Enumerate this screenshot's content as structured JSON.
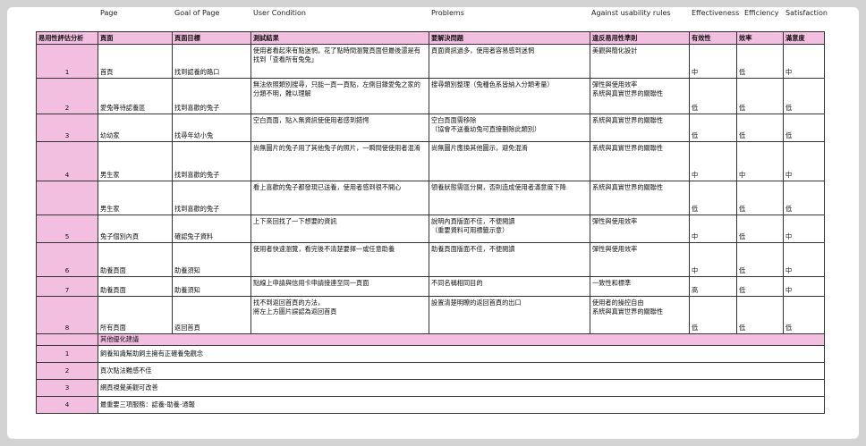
{
  "english_headers": {
    "page": "Page",
    "goal": "Goal of Page",
    "condition": "User Condition",
    "problems": "Problems",
    "rules": "Against usability rules",
    "effectiveness": "Effectiveness",
    "efficiency": "Efficiency",
    "satisfaction": "Satisfaction"
  },
  "table_header": {
    "title": "易用性評估分析",
    "page": "頁面",
    "goal": "頁面目標",
    "result": "測試結果",
    "problem": "要解決問題",
    "rule": "違反易用性準則",
    "effectiveness": "有效性",
    "efficiency": "效率",
    "satisfaction": "滿意度"
  },
  "rows": [
    {
      "idx": "1",
      "page": "首頁",
      "goal": "找到認養的路口",
      "result": "使用者看起來有點迷惘，花了點時間瀏覽頁面但最後還是有找到「查看所有兔兔」",
      "problem": "頁面資訊過多，使用者容易感到迷惘",
      "rule": "美觀與簡化設計",
      "eff": "中",
      "effc": "低",
      "sat": "中"
    },
    {
      "idx": "2",
      "page": "愛兔等待認養區",
      "goal": "找到喜歡的兔子",
      "result": "無法依照類別搜尋，只能一頁一頁點，左側目錄愛兔之家的分類不明，難以理解",
      "problem": "搜尋類別整理（兔種色系皆納入分類考量）",
      "rule": "彈性與使用效率\n系統與真實世界的關聯性",
      "eff": "低",
      "effc": "低",
      "sat": "低"
    },
    {
      "idx": "3",
      "page": "幼幼家",
      "goal": "找尋年幼小兔",
      "result": "空白頁面，點入無資訊使使用者感到錯愕",
      "problem": "空白頁面需移除\n（協會不送養幼兔可直接刪除此類別）",
      "rule": "系統與真實世界的關聯性",
      "eff": "低",
      "effc": "低",
      "sat": "低"
    },
    {
      "idx": "4",
      "page": "男生家",
      "goal": "找到喜歡的兔子",
      "result": "尚無圖片的兔子用了其他兔子的照片，一瞬間使使用者混淆",
      "problem": "尚無圖片應換其他圖示，避免混淆",
      "rule": "系統與真實世界的關聯性",
      "eff": "中",
      "effc": "中",
      "sat": "中"
    },
    {
      "idx": "",
      "page": "男生家",
      "goal": "找到喜歡的兔子",
      "result": "看上喜歡的兔子都發現已送養，使用者感到很不開心",
      "problem": "領養狀態需區分開，否則造成使用者滿意度下降",
      "rule": "系統與真實世界的關聯性",
      "eff": "低",
      "effc": "低",
      "sat": "低"
    },
    {
      "idx": "5",
      "page": "兔子個別內頁",
      "goal": "確認兔子資料",
      "result": "上下來回找了一下想要的資訊",
      "problem": "說明內頁版面不佳，不便閱讀\n（重要資料可用標籤示意）",
      "rule": "彈性與使用效率",
      "eff": "中",
      "effc": "低",
      "sat": "中"
    },
    {
      "idx": "6",
      "page": "助養頁面",
      "goal": "助養須知",
      "result": "使用者快速瀏覽，看完後不清楚要擇一或任意助養",
      "problem": "助養頁面版面不佳，不便閱讀",
      "rule": "彈性與使用效率",
      "eff": "中",
      "effc": "低",
      "sat": "中"
    },
    {
      "idx": "7",
      "page": "助養頁面",
      "goal": "助養須知",
      "result": "點線上申請與信用卡申請接連至同一頁面",
      "problem": "不同名稱相同目的",
      "rule": "一致性和標準",
      "eff": "高",
      "effc": "低",
      "sat": "中"
    },
    {
      "idx": "8",
      "page": "所有頁面",
      "goal": "返回首頁",
      "result": "找不到返回首頁的方法，\n將左上方圖片誤認為返回首頁",
      "problem": "設置清楚明瞭的返回首頁的出口",
      "rule": "使用者的操控自由\n系統與真實世界的關聯性",
      "eff": "低",
      "effc": "低",
      "sat": "低"
    }
  ],
  "other_title": "其他優化建議",
  "other_rows": [
    {
      "idx": "1",
      "text": "飼養知識幫助飼主擁有正確養兔觀念"
    },
    {
      "idx": "2",
      "text": "頁次點法難感不佳"
    },
    {
      "idx": "3",
      "text": "網頁視覺美觀可改善"
    },
    {
      "idx": "4",
      "text": "最重要三項服務：認養-助養-通報"
    }
  ]
}
